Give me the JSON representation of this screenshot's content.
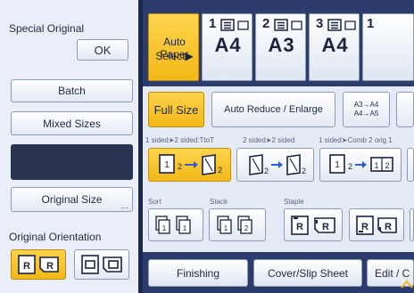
{
  "special_original": {
    "label": "Special Original",
    "ok_label": "OK"
  },
  "left_buttons": {
    "batch": "Batch",
    "mixed_sizes": "Mixed Sizes",
    "original_size": "Original Size"
  },
  "orientation": {
    "label": "Original Orientation"
  },
  "paper": {
    "auto_line1": "Auto Paper",
    "auto_line2": "Select▶",
    "trays": [
      {
        "number": "1",
        "size": "A4"
      },
      {
        "number": "2",
        "size": "A3"
      },
      {
        "number": "3",
        "size": "A4"
      }
    ]
  },
  "reduce": {
    "full_size": "Full Size",
    "auto_reduce": "Auto Reduce / Enlarge",
    "preset_line1": "A3→A4",
    "preset_line2": "A4→A5"
  },
  "duplex_labels": {
    "one_two_toT": "1 sided➤2 sided:TtoT",
    "two_two": "2 sided➤2 sided",
    "comb": "1 sided➤Comb 2 orig 1"
  },
  "finish_labels": {
    "sort": "Sort",
    "stack": "Stack",
    "staple": "Staple"
  },
  "bottom_tabs": {
    "finishing": "Finishing",
    "cover_slip": "Cover/Slip Sheet",
    "edit": "Edit / C"
  },
  "colors": {
    "selected": "#f2b817",
    "panel_dark": "#2c3c6c"
  }
}
